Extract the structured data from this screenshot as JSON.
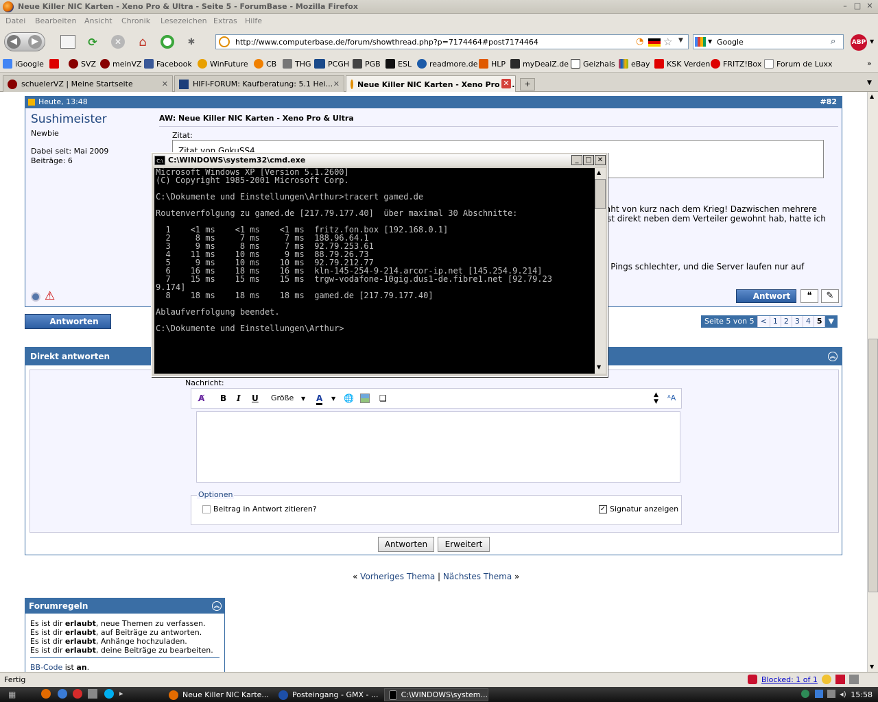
{
  "window": {
    "title": "Neue Killer NIC Karten - Xeno Pro & Ultra - Seite 5 - ForumBase - Mozilla Firefox"
  },
  "menu": [
    "Datei",
    "Bearbeiten",
    "Ansicht",
    "Chronik",
    "Lesezeichen",
    "Extras",
    "Hilfe"
  ],
  "nav": {
    "url": "http://www.computerbase.de/forum/showthread.php?p=7174464#post7174464",
    "search_text": "Google",
    "abp_label": "ABP"
  },
  "bookmarks": [
    "iGoogle",
    "SVZ",
    "meinVZ",
    "Facebook",
    "WinFuture",
    "CB",
    "THG",
    "PCGH",
    "PGB",
    "ESL",
    "readmore.de",
    "HLP",
    "myDealZ.de",
    "Geizhals",
    "eBay",
    "KSK Verden",
    "FRITZ!Box",
    "Forum de Luxx"
  ],
  "tabs": [
    {
      "label": "schuelerVZ | Meine Startseite"
    },
    {
      "label": "HIFI-FORUM: Kaufberatung: 5.1 Hei..."
    },
    {
      "label": "Neue Killer NIC Karten - Xeno Pro &..."
    }
  ],
  "post": {
    "date": "Heute, 13:48",
    "number": "#82",
    "username": "Sushimeister",
    "rank": "Newbie",
    "joined": "Dabei seit: Mai 2009",
    "posts": "Beiträge: 6",
    "title": "AW: Neue Killer NIC Karten - Xeno Pro & Ultra",
    "zitat_label": "Zitat:",
    "quote_from": "Zitat von GokuSS4",
    "text_line1": "raht von kurz nach dem Krieg! Dazwischen mehrere",
    "text_line2": "st direkt neben dem Verteiler gewohnt hab, hatte ich",
    "text_line3": "e Pings schlechter, und die Server laufen nur auf",
    "reply_label": "Antwort"
  },
  "reply_button": "Antworten",
  "pagination": {
    "label": "Seite 5 von 5",
    "prev": "<",
    "pages": [
      "1",
      "2",
      "3",
      "4"
    ],
    "current": "5"
  },
  "quick_reply": {
    "title": "Direkt antworten",
    "message_label": "Nachricht:",
    "size_label": "Größe",
    "options_legend": "Optionen",
    "quote_option": "Beitrag in Antwort zitieren?",
    "signature_option": "Signatur anzeigen",
    "submit": "Antworten",
    "advanced": "Erweitert"
  },
  "thread_nav": {
    "prev": "Vorheriges Thema",
    "next": "Nächstes Thema"
  },
  "rules": {
    "title": "Forumregeln",
    "prefix": "Es ist dir",
    "allowed": "erlaubt",
    "lines": [
      ", neue Themen zu verfassen.",
      ", auf Beiträge zu antworten.",
      ", Anhänge hochzuladen.",
      ", deine Beiträge zu bearbeiten."
    ],
    "bbcode": "BB-Code",
    "bbcode_state": "an",
    "bbcode_is": "ist"
  },
  "cmd": {
    "title": "C:\\WINDOWS\\system32\\cmd.exe",
    "icon": "C:\\",
    "output": "Microsoft Windows XP [Version 5.1.2600]\n(C) Copyright 1985-2001 Microsoft Corp.\n\nC:\\Dokumente und Einstellungen\\Arthur>tracert gamed.de\n\nRoutenverfolgung zu gamed.de [217.79.177.40]  über maximal 30 Abschnitte:\n\n  1    <1 ms    <1 ms    <1 ms  fritz.fon.box [192.168.0.1]\n  2     8 ms     7 ms     7 ms  188.96.64.1\n  3     9 ms     8 ms     7 ms  92.79.253.61\n  4    11 ms    10 ms     9 ms  88.79.26.73\n  5     9 ms    10 ms    10 ms  92.79.212.77\n  6    16 ms    18 ms    16 ms  kln-145-254-9-214.arcor-ip.net [145.254.9.214]\n  7    15 ms    15 ms    15 ms  trgw-vodafone-10gig.dus1-de.fibre1.net [92.79.23\n9.174]\n  8    18 ms    18 ms    18 ms  gamed.de [217.79.177.40]\n\nAblaufverfolgung beendet.\n\nC:\\Dokumente und Einstellungen\\Arthur>"
  },
  "status": {
    "text": "Fertig",
    "blocked": "Blocked: 1 of 1"
  },
  "taskbar": {
    "items": [
      "Neue Killer NIC Karte...",
      "Posteingang - GMX - ...",
      "C:\\WINDOWS\\system..."
    ],
    "clock": "15:58"
  }
}
